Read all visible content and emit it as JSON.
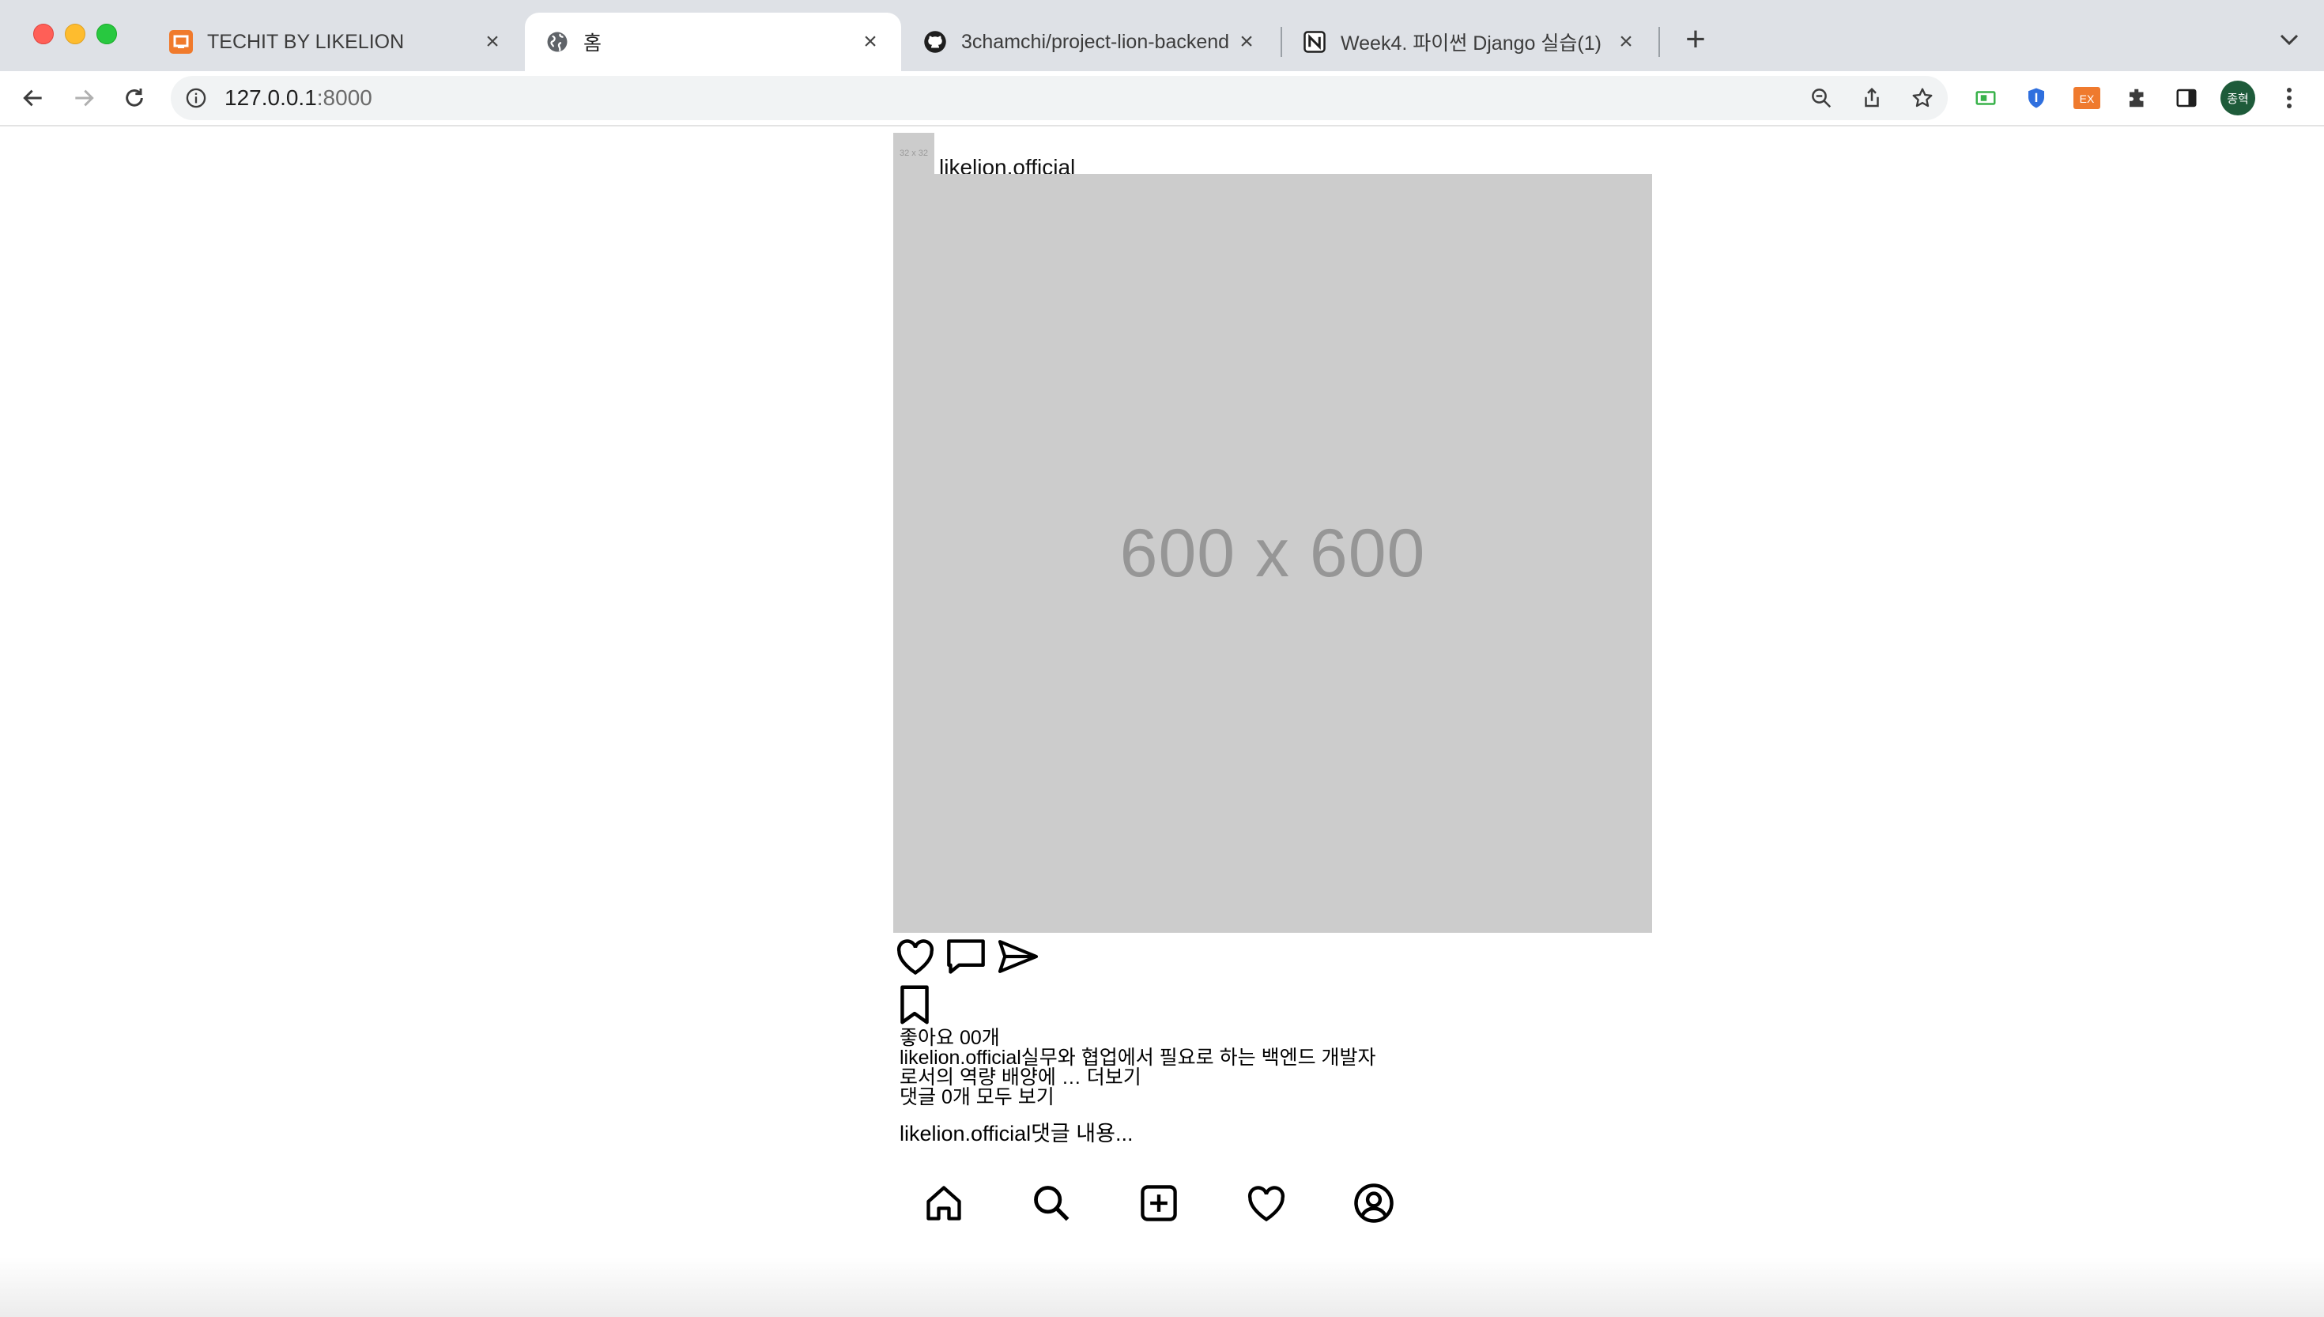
{
  "browser": {
    "tabs": [
      {
        "title": "TECHIT BY LIKELION",
        "favicon": "techit-favicon",
        "active": false
      },
      {
        "title": "홈",
        "favicon": "globe-icon",
        "active": true
      },
      {
        "title": "3chamchi/project-lion-backend",
        "favicon": "github-icon",
        "active": false
      },
      {
        "title": "Week4. 파이썬 Django 실습(1)",
        "favicon": "notion-icon",
        "active": false
      }
    ],
    "url_host": "127.0.0.1",
    "url_port": ":8000",
    "profile_label": "종혁"
  },
  "post": {
    "profile_placeholder": "32 x 32",
    "username": "likelion.official",
    "image_placeholder": "600 x 600",
    "likes_text": "좋아요 00개",
    "caption_line1": "likelion.official실무와 협업에서 필요로 하는 백엔드 개발자",
    "caption_line2": "로서의 역량 배양에 … 더보기",
    "comments_link": "댓글 0개 모두 보기",
    "comment_preview": "likelion.official댓글 내용..."
  },
  "bottom_nav": [
    "home-icon",
    "search-icon",
    "add-post-icon",
    "heart-icon",
    "profile-icon"
  ]
}
